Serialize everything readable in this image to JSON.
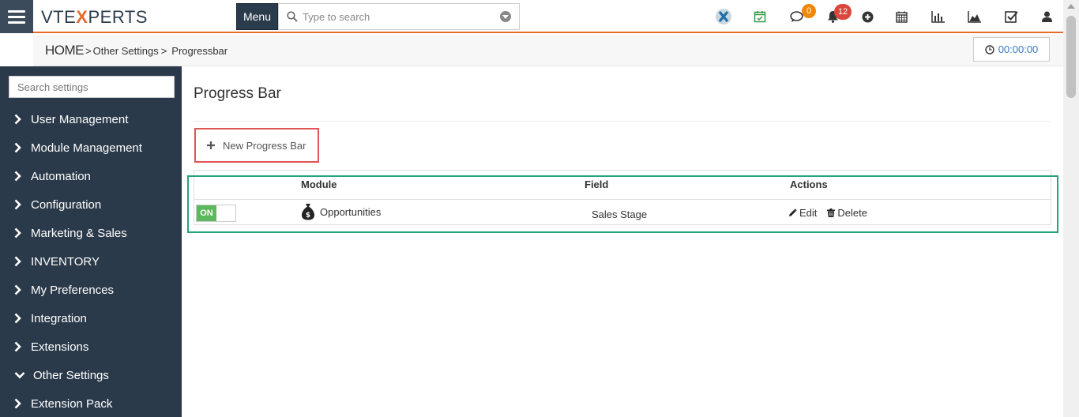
{
  "header": {
    "logo_left": "VTE",
    "logo_x": "X",
    "logo_right": "PERTS",
    "menu_label": "Menu",
    "search_placeholder": "Type to search",
    "chat_badge": "0",
    "notify_badge": "12",
    "colors": {
      "accent": "#e86a2b",
      "chat_badge": "#f0870a",
      "notify_badge": "#d9473d"
    }
  },
  "breadcrumb": {
    "home": "HOME",
    "sep": ">",
    "level1": "Other Settings",
    "level2": "Progressbar"
  },
  "timer": {
    "value": "00:00:00"
  },
  "sidebar": {
    "search_placeholder": "Search settings",
    "items": [
      {
        "label": "User Management",
        "expanded": false
      },
      {
        "label": "Module Management",
        "expanded": false
      },
      {
        "label": "Automation",
        "expanded": false
      },
      {
        "label": "Configuration",
        "expanded": false
      },
      {
        "label": "Marketing & Sales",
        "expanded": false
      },
      {
        "label": "INVENTORY",
        "expanded": false
      },
      {
        "label": "My Preferences",
        "expanded": false
      },
      {
        "label": "Integration",
        "expanded": false
      },
      {
        "label": "Extensions",
        "expanded": false
      },
      {
        "label": "Other Settings",
        "expanded": true
      },
      {
        "label": "Extension Pack",
        "expanded": false
      }
    ]
  },
  "main": {
    "title": "Progress Bar",
    "new_button": "New Progress Bar",
    "table": {
      "headers": {
        "module": "Module",
        "field": "Field",
        "actions": "Actions"
      },
      "rows": [
        {
          "status": "ON",
          "module": "Opportunities",
          "field": "Sales Stage",
          "edit": "Edit",
          "delete": "Delete"
        }
      ]
    }
  }
}
